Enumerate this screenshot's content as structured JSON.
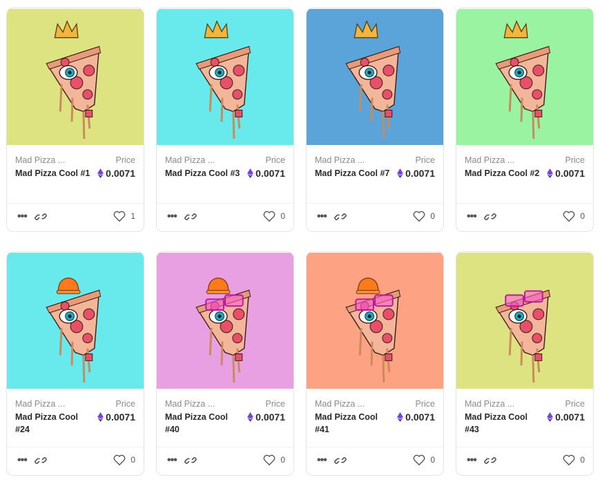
{
  "price_label": "Price",
  "icons": {
    "more": "more-dots-icon",
    "link": "link-icon",
    "like": "heart-icon",
    "currency": "ethereum-icon"
  },
  "colors": {
    "eth_purple": "#7b3fe4",
    "accent_hat": "#ff7a1a"
  },
  "cards": [
    {
      "collection": "Mad Pizza ...",
      "title": "Mad Pizza Cool #1",
      "price": "0.0071",
      "likes": "1",
      "bg": "#dee381",
      "accessory": "crown"
    },
    {
      "collection": "Mad Pizza ...",
      "title": "Mad Pizza Cool #3",
      "price": "0.0071",
      "likes": "0",
      "bg": "#68e9ec",
      "accessory": "crown"
    },
    {
      "collection": "Mad Pizza ...",
      "title": "Mad Pizza Cool #7",
      "price": "0.0071",
      "likes": "0",
      "bg": "#5ba4d9",
      "accessory": "crown"
    },
    {
      "collection": "Mad Pizza ...",
      "title": "Mad Pizza Cool #2",
      "price": "0.0071",
      "likes": "0",
      "bg": "#99f3a0",
      "accessory": "crown"
    },
    {
      "collection": "Mad Pizza ...",
      "title": "Mad Pizza Cool #24",
      "price": "0.0071",
      "likes": "0",
      "bg": "#68e9ec",
      "accessory": "hat"
    },
    {
      "collection": "Mad Pizza ...",
      "title": "Mad Pizza Cool #40",
      "price": "0.0071",
      "likes": "0",
      "bg": "#e9a0e3",
      "accessory": "hat-glasses"
    },
    {
      "collection": "Mad Pizza ...",
      "title": "Mad Pizza Cool #41",
      "price": "0.0071",
      "likes": "0",
      "bg": "#fda282",
      "accessory": "hat-glasses"
    },
    {
      "collection": "Mad Pizza ...",
      "title": "Mad Pizza Cool #43",
      "price": "0.0071",
      "likes": "0",
      "bg": "#dee381",
      "accessory": "glasses"
    }
  ]
}
